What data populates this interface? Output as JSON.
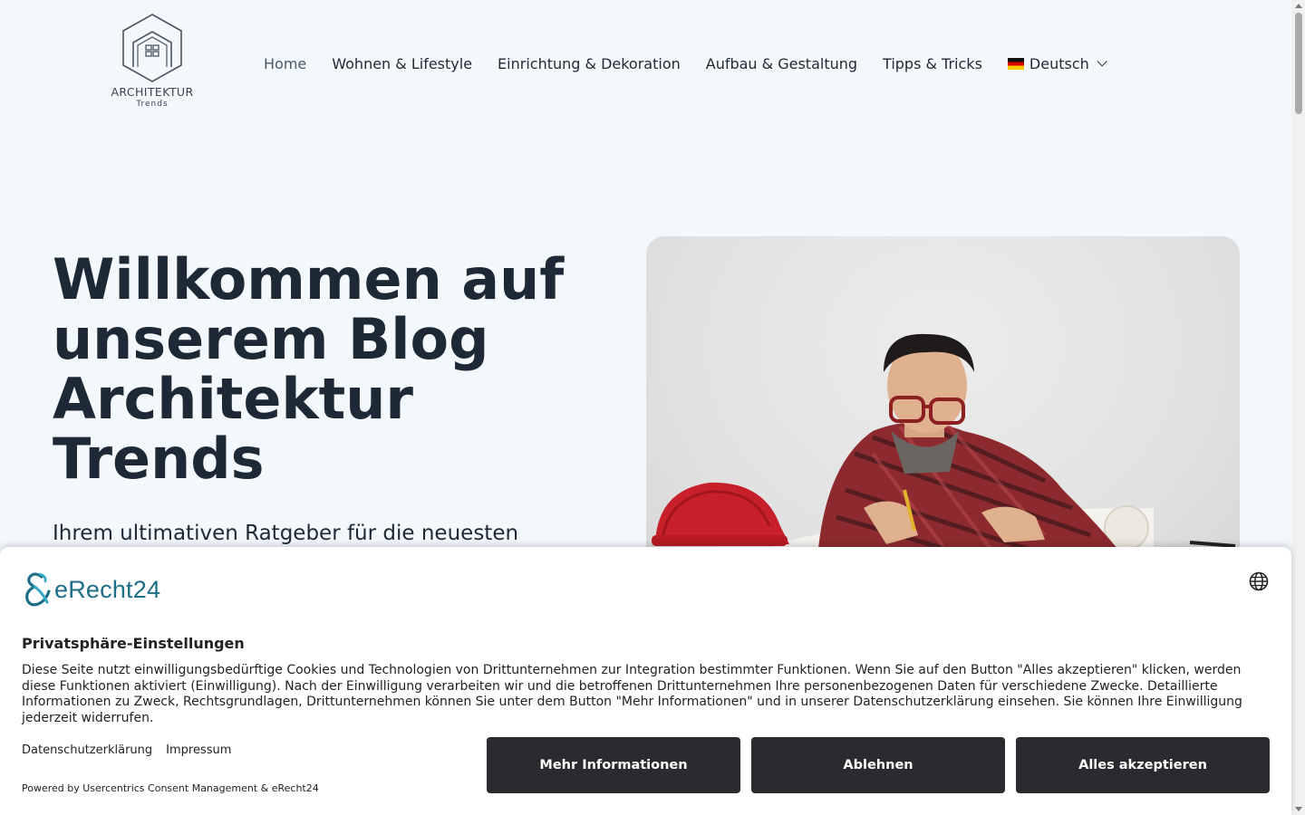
{
  "header": {
    "logo_title": "ARCHITEKTUR",
    "logo_subtitle": "Trends"
  },
  "nav": {
    "items": [
      {
        "label": "Home",
        "active": true
      },
      {
        "label": "Wohnen & Lifestyle"
      },
      {
        "label": "Einrichtung & Dekoration"
      },
      {
        "label": "Aufbau & Gestaltung"
      },
      {
        "label": "Tipps & Tricks"
      }
    ],
    "language": {
      "label": "Deutsch",
      "flag_icon": "german-flag-icon"
    }
  },
  "hero": {
    "title": "Willkommen auf unserem Blog Architektur Trends",
    "subtitle": "Ihrem ultimativen Ratgeber für die neuesten"
  },
  "consent": {
    "brand": "eRecht24",
    "title": "Privatsphäre-Einstellungen",
    "text": "Diese Seite nutzt einwilligungsbedürftige Cookies und Technologien von Drittunternehmen zur Integration bestimmter Funktionen. Wenn Sie auf den Button \"Alles akzeptieren\" klicken, werden diese Funktionen aktiviert (Einwilligung). Nach der Einwilligung verarbeiten wir und die betroffenen Drittunternehmen Ihre personenbezogenen Daten für verschiedene Zwecke. Detaillierte Informationen zu Zweck, Rechtsgrundlagen, Drittunternehmen können Sie unter dem Button \"Mehr Informationen\" und in unserer Datenschutzerklärung einsehen. Sie können Ihre Einwilligung jederzeit widerrufen.",
    "links": {
      "privacy": "Datenschutzerklärung",
      "imprint": "Impressum"
    },
    "powered_by": "Powered by Usercentrics Consent Management & eRecht24",
    "buttons": {
      "more": "Mehr Informationen",
      "deny": "Ablehnen",
      "accept": "Alles akzeptieren"
    }
  },
  "colors": {
    "page_bg": "#f3f8fc",
    "heading": "#1d2934",
    "button_bg": "#2a2b2e",
    "brand_teal": "#1d6e86"
  }
}
